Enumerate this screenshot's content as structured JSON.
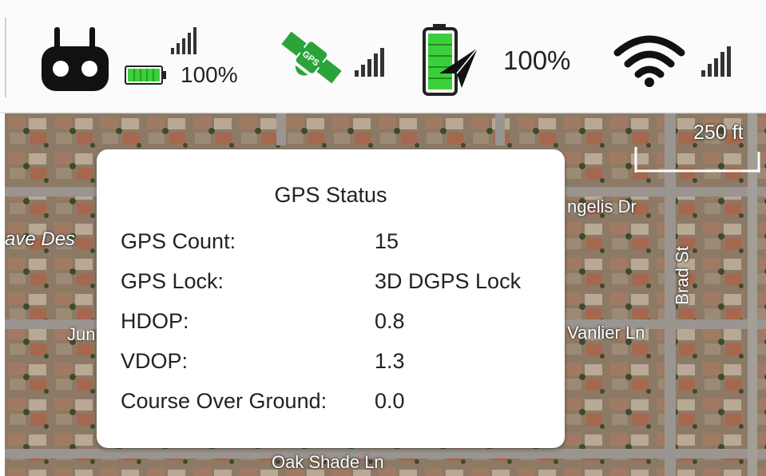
{
  "status_bar": {
    "controller_battery_percent": "100%",
    "aircraft_battery_percent": "100%",
    "gps_icon_text": "GPS"
  },
  "map": {
    "scale_label": "250 ft",
    "streets": {
      "angelis": "ngelis Dr",
      "cave": "ave Des",
      "brad": "Brad St",
      "jun": "Jun",
      "vanlier": "Vanlier Ln",
      "oak": "Oak Shade Ln"
    }
  },
  "gps_dialog": {
    "title": "GPS Status",
    "rows": [
      {
        "label": "GPS Count:",
        "value": "15"
      },
      {
        "label": "GPS Lock:",
        "value": "3D DGPS Lock"
      },
      {
        "label": "HDOP:",
        "value": "0.8"
      },
      {
        "label": "VDOP:",
        "value": "1.3"
      },
      {
        "label": "Course Over Ground:",
        "value": "0.0"
      }
    ]
  },
  "colors": {
    "accent_green": "#2aa43a",
    "battery_green": "#3ccf3c",
    "text": "#222222"
  }
}
